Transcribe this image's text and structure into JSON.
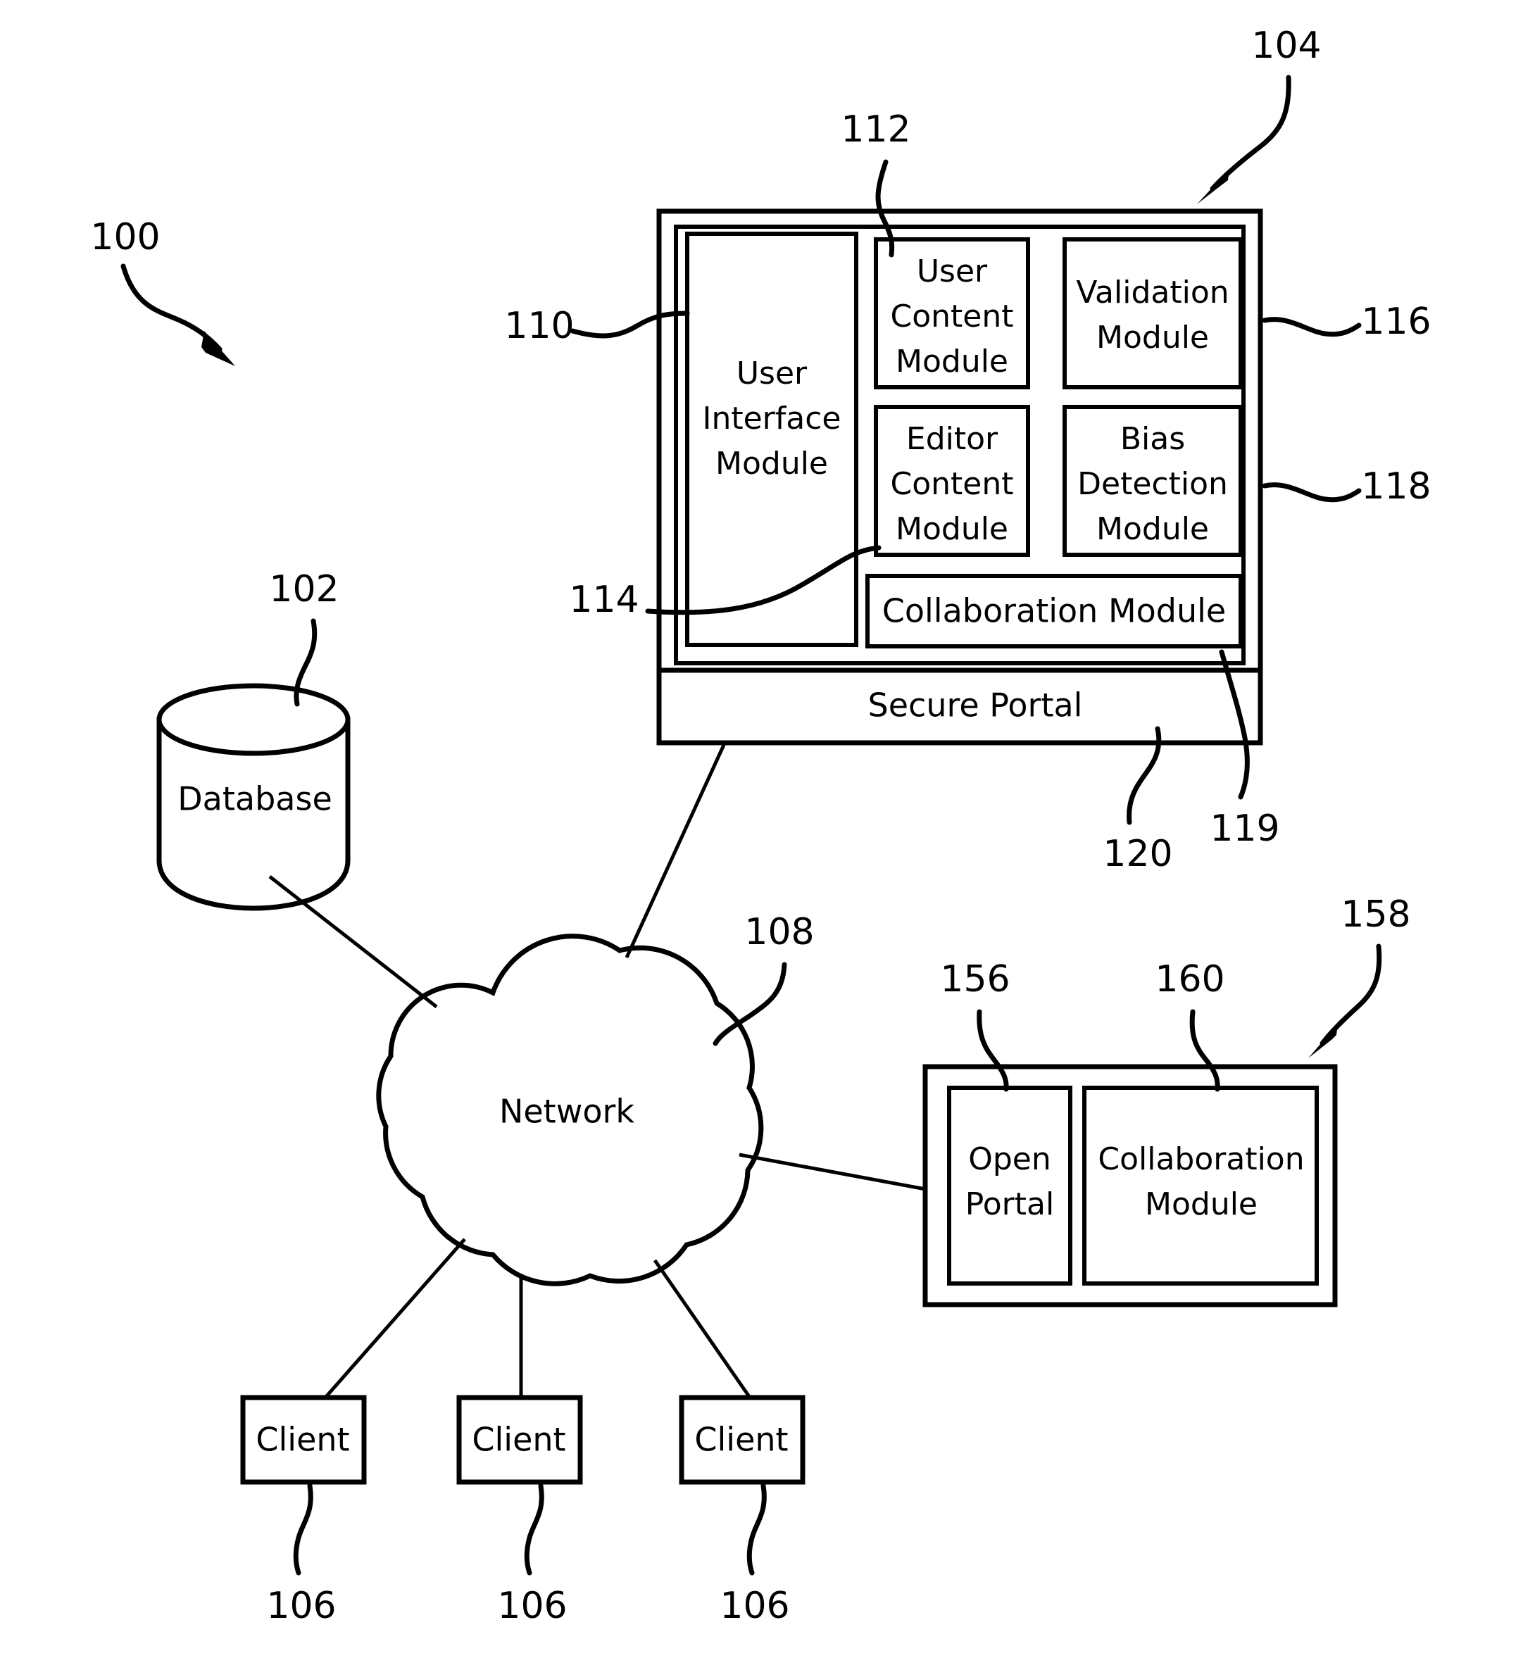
{
  "figure": {
    "kind": "patent-system-architecture-diagram",
    "background_color": "#ffffff",
    "line_color": "#000000"
  },
  "system": {
    "numeral": "100"
  },
  "server": {
    "numeral": "104",
    "portal_label": "Secure Portal",
    "portal_numeral": "120",
    "inner_panel_numeral": "119",
    "modules": [
      {
        "id": "ui",
        "label": "User\nInterface\nModule",
        "numeral": "110"
      },
      {
        "id": "user-content",
        "label": "User\nContent\nModule",
        "numeral": "112"
      },
      {
        "id": "editor-content",
        "label": "Editor\nContent\nModule",
        "numeral": "114"
      },
      {
        "id": "validation",
        "label": "Validation\nModule",
        "numeral": "116"
      },
      {
        "id": "bias",
        "label": "Bias\nDetection\nModule",
        "numeral": "118"
      },
      {
        "id": "collaboration",
        "label": "Collaboration  Module",
        "numeral": "119"
      }
    ],
    "module_text": {
      "ui_line1": "User",
      "ui_line2": "Interface",
      "ui_line3": "Module",
      "user_content_line1": "User",
      "user_content_line2": "Content",
      "user_content_line3": "Module",
      "editor_content_line1": "Editor",
      "editor_content_line2": "Content",
      "editor_content_line3": "Module",
      "validation_line1": "Validation",
      "validation_line2": "Module",
      "bias_line1": "Bias",
      "bias_line2": "Detection",
      "bias_line3": "Module",
      "collaboration": "Collaboration  Module"
    }
  },
  "database": {
    "label": "Database",
    "numeral": "102"
  },
  "network": {
    "label": "Network",
    "numeral": "108"
  },
  "clients": [
    {
      "label": "Client",
      "numeral": "106"
    },
    {
      "label": "Client",
      "numeral": "106"
    },
    {
      "label": "Client",
      "numeral": "106"
    }
  ],
  "open_system": {
    "numeral": "158",
    "open_portal": {
      "line1": "Open",
      "line2": "Portal",
      "numeral": "156"
    },
    "collaboration": {
      "line1": "Collaboration",
      "line2": "Module",
      "numeral": "160"
    }
  },
  "numerals": {
    "n100": "100",
    "n102": "102",
    "n104": "104",
    "n106a": "106",
    "n106b": "106",
    "n106c": "106",
    "n108": "108",
    "n110": "110",
    "n112": "112",
    "n114": "114",
    "n116": "116",
    "n118": "118",
    "n119": "119",
    "n120": "120",
    "n156": "156",
    "n158": "158",
    "n160": "160"
  }
}
